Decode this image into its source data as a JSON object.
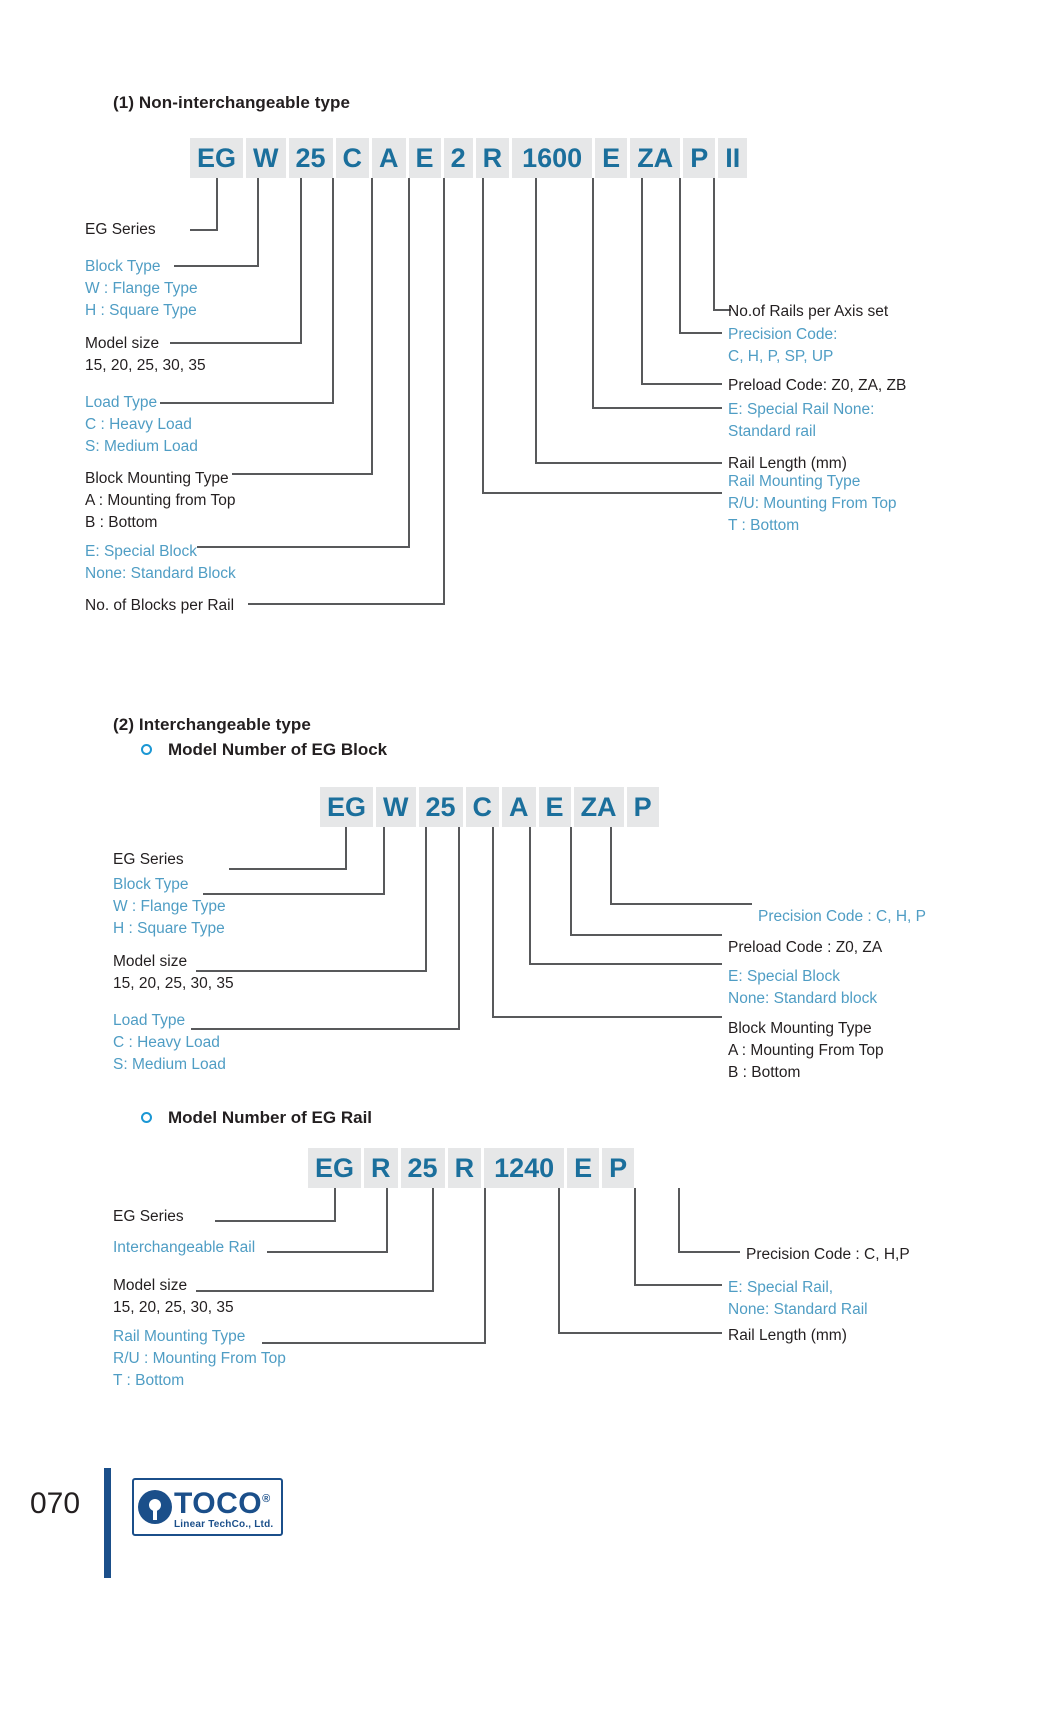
{
  "page": {
    "number": "070",
    "logo": {
      "word": "TOCO",
      "registered": "®",
      "subtitle": "Linear TechCo., Ltd."
    }
  },
  "section1": {
    "heading": "(1) Non-interchangeable type",
    "code_cells": [
      "EG",
      "W",
      "25",
      "C",
      "A",
      "E",
      "2",
      "R",
      "1600",
      "E",
      "ZA",
      "P",
      "II"
    ],
    "left_labels": [
      {
        "lines": [
          {
            "text": "EG Series",
            "color": "dark"
          }
        ]
      },
      {
        "lines": [
          {
            "text": "Block  Type",
            "color": "blue"
          },
          {
            "text": "W : Flange Type",
            "color": "blue"
          },
          {
            "text": "H : Square Type",
            "color": "blue"
          }
        ]
      },
      {
        "lines": [
          {
            "text": "Model size",
            "color": "dark"
          },
          {
            "text": "15, 20, 25, 30, 35",
            "color": "dark"
          }
        ]
      },
      {
        "lines": [
          {
            "text": "Load Type",
            "color": "blue"
          },
          {
            "text": "C : Heavy Load",
            "color": "blue"
          },
          {
            "text": "S: Medium Load",
            "color": "blue"
          }
        ]
      },
      {
        "lines": [
          {
            "text": "Block Mounting Type",
            "color": "dark"
          },
          {
            "text": "A : Mounting from Top",
            "color": "dark"
          },
          {
            "text": "B : Bottom",
            "color": "dark"
          }
        ]
      },
      {
        "lines": [
          {
            "text": "E: Special Block",
            "color": "blue"
          },
          {
            "text": "None: Standard Block",
            "color": "blue"
          }
        ]
      },
      {
        "lines": [
          {
            "text": "No. of Blocks per Rail",
            "color": "dark"
          }
        ]
      }
    ],
    "right_labels": [
      {
        "lines": [
          {
            "text": "No.of Rails per Axis set",
            "color": "dark"
          }
        ]
      },
      {
        "lines": [
          {
            "text": "Precision Code:",
            "color": "blue"
          },
          {
            "text": "C, H, P, SP, UP",
            "color": "blue"
          }
        ]
      },
      {
        "lines": [
          {
            "text": "Preload Code: Z0, ZA, ZB",
            "color": "dark"
          }
        ]
      },
      {
        "lines": [
          {
            "text": "E: Special Rail None:",
            "color": "blue"
          },
          {
            "text": "Standard rail",
            "color": "blue"
          }
        ]
      },
      {
        "lines": [
          {
            "text": "Rail Length (mm)",
            "color": "dark"
          }
        ]
      },
      {
        "lines": [
          {
            "text": "Rail Mounting Type",
            "color": "blue"
          },
          {
            "text": "R/U: Mounting From Top",
            "color": "blue"
          },
          {
            "text": "T : Bottom",
            "color": "blue"
          }
        ]
      }
    ]
  },
  "section2": {
    "heading": "(2) Interchangeable type",
    "block": {
      "subheading": "Model Number of EG Block",
      "code_cells": [
        "EG",
        "W",
        "25",
        "C",
        "A",
        "E",
        "ZA",
        "P"
      ],
      "left_labels": [
        {
          "lines": [
            {
              "text": "EG Series",
              "color": "dark"
            }
          ]
        },
        {
          "lines": [
            {
              "text": "Block Type",
              "color": "blue"
            },
            {
              "text": "W : Flange Type",
              "color": "blue"
            },
            {
              "text": "H : Square Type",
              "color": "blue"
            }
          ]
        },
        {
          "lines": [
            {
              "text": "Model size",
              "color": "dark"
            },
            {
              "text": "15, 20, 25, 30, 35",
              "color": "dark"
            }
          ]
        },
        {
          "lines": [
            {
              "text": "Load Type",
              "color": "blue"
            },
            {
              "text": "C : Heavy Load",
              "color": "blue"
            },
            {
              "text": "S: Medium Load",
              "color": "blue"
            }
          ]
        }
      ],
      "right_labels": [
        {
          "lines": [
            {
              "text": "Precision Code : C, H, P",
              "color": "blue"
            }
          ]
        },
        {
          "lines": [
            {
              "text": "Preload Code : Z0, ZA",
              "color": "dark"
            }
          ]
        },
        {
          "lines": [
            {
              "text": "E: Special Block",
              "color": "blue"
            },
            {
              "text": "None: Standard block",
              "color": "blue"
            }
          ]
        },
        {
          "lines": [
            {
              "text": "Block Mounting Type",
              "color": "dark"
            },
            {
              "text": "A : Mounting From Top",
              "color": "dark"
            },
            {
              "text": "B : Bottom",
              "color": "dark"
            }
          ]
        }
      ]
    },
    "rail": {
      "subheading": "Model Number of EG Rail",
      "code_cells": [
        "EG",
        "R",
        "25",
        "R",
        "1240",
        "E",
        "P"
      ],
      "left_labels": [
        {
          "lines": [
            {
              "text": "EG Series",
              "color": "dark"
            }
          ]
        },
        {
          "lines": [
            {
              "text": "Interchangeable Rail",
              "color": "blue"
            }
          ]
        },
        {
          "lines": [
            {
              "text": "Model size",
              "color": "dark"
            },
            {
              "text": "15, 20, 25, 30, 35",
              "color": "dark"
            }
          ]
        },
        {
          "lines": [
            {
              "text": "Rail Mounting Type",
              "color": "blue"
            },
            {
              "text": "R/U : Mounting From Top",
              "color": "blue"
            },
            {
              "text": "T : Bottom",
              "color": "blue"
            }
          ]
        }
      ],
      "right_labels": [
        {
          "lines": [
            {
              "text": "Precision Code : C, H,P",
              "color": "dark"
            }
          ]
        },
        {
          "lines": [
            {
              "text": "E: Special Rail,",
              "color": "blue"
            },
            {
              "text": "None: Standard Rail",
              "color": "blue"
            }
          ]
        },
        {
          "lines": [
            {
              "text": "Rail Length (mm)",
              "color": "dark"
            }
          ]
        }
      ]
    }
  },
  "colors": {
    "code_text": "#1b6f9c",
    "code_bg": "#e6e7e8",
    "blue_label": "#4f9dc4",
    "dark_label": "#231f20",
    "leader": "#58595b",
    "brand": "#1b4f8a",
    "accent_ring": "#1b97d4"
  }
}
